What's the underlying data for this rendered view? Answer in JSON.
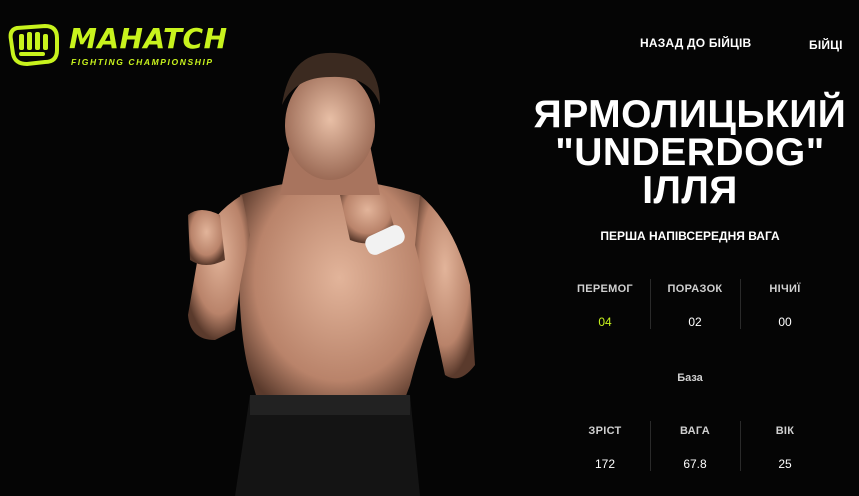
{
  "brand": {
    "name": "MAHATCH",
    "subtitle": "FIGHTING CHAMPIONSHIP",
    "accent_color": "#c8f31d",
    "icon": "fist-icon"
  },
  "nav": {
    "back_label": "НАЗАД ДО БІЙЦІВ",
    "fighters_label": "БІЙЦІ"
  },
  "fighter": {
    "surname": "ЯРМОЛИЦЬКИЙ",
    "nickname": "\"UNDERDOG\"",
    "first_name": "ІЛЛЯ",
    "weight_class": "ПЕРША НАПІВСЕРЕДНЯ ВАГА",
    "record": {
      "wins_label": "ПЕРЕМОГ",
      "wins": "04",
      "losses_label": "ПОРАЗОК",
      "losses": "02",
      "draws_label": "НІЧИЇ",
      "draws": "00"
    },
    "base_label": "База",
    "body": {
      "height_label": "ЗРІСТ",
      "height": "172",
      "weight_label": "ВАГА",
      "weight": "67.8",
      "age_label": "ВІК",
      "age": "25"
    }
  }
}
